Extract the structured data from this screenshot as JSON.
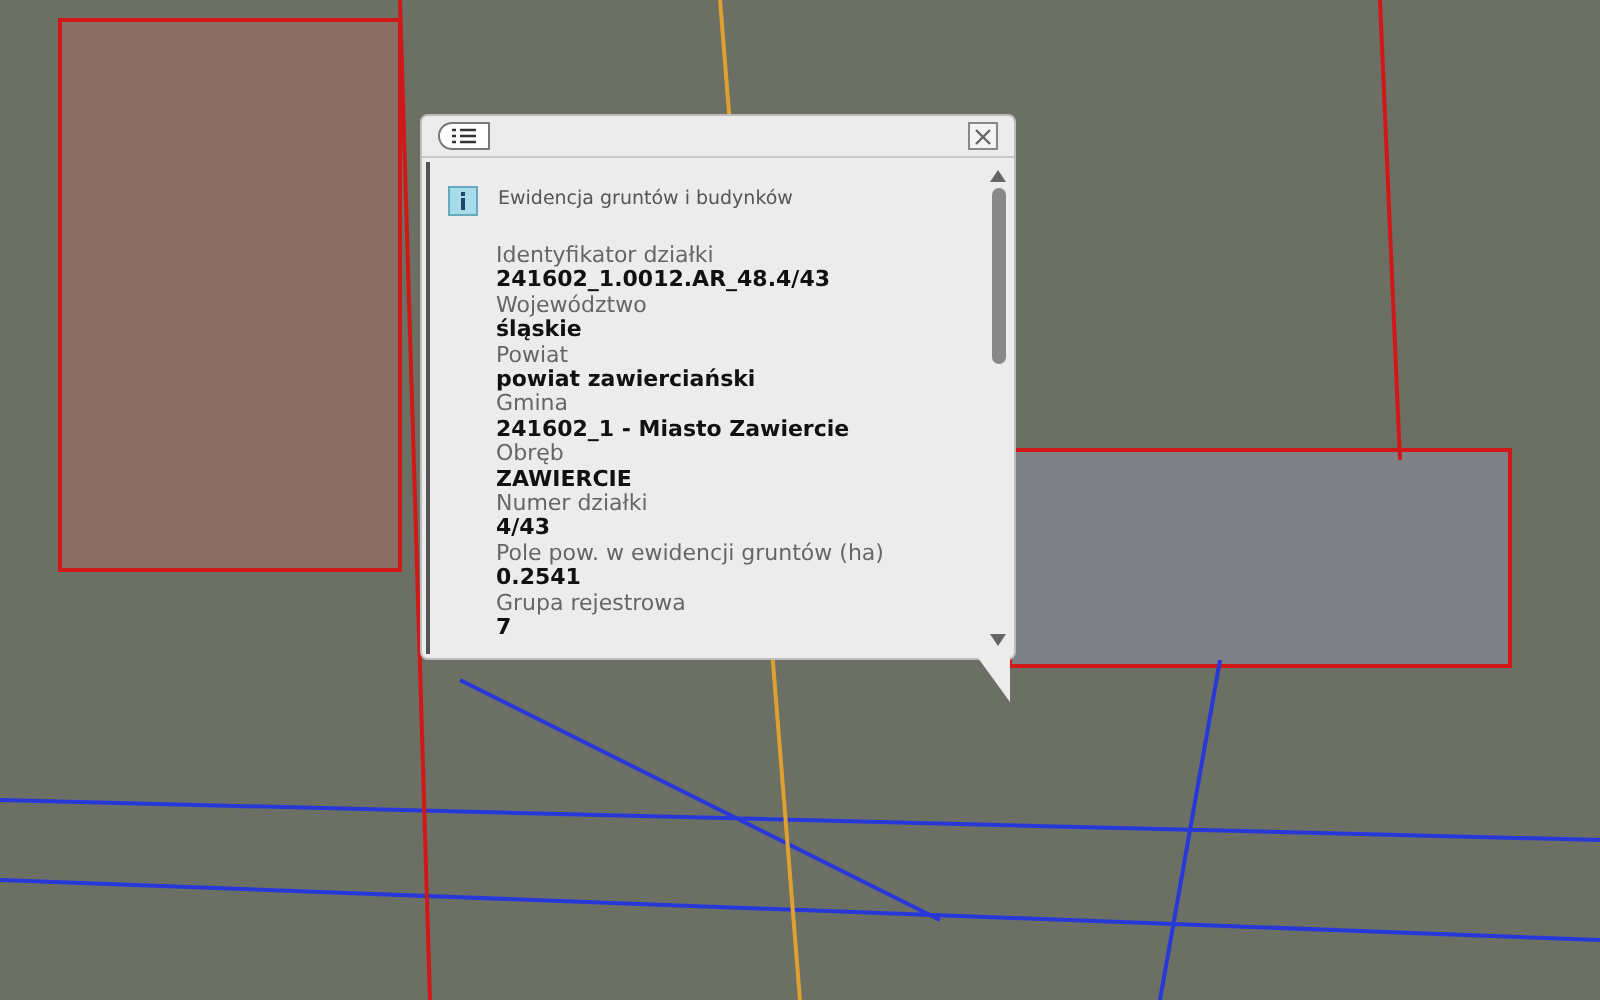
{
  "popup": {
    "title": "Ewidencja gruntów i budynków",
    "fields": [
      {
        "label": "Identyfikator działki",
        "value": "241602_1.0012.AR_48.4/43"
      },
      {
        "label": "Województwo",
        "value": "śląskie"
      },
      {
        "label": "Powiat",
        "value": "powiat zawierciański"
      },
      {
        "label": "Gmina",
        "value": "241602_1 - Miasto Zawiercie"
      },
      {
        "label": "Obręb",
        "value": "ZAWIERCIE"
      },
      {
        "label": "Numer działki",
        "value": "4/43"
      },
      {
        "label": "Pole pow. w ewidencji gruntów (ha)",
        "value": "0.2541"
      },
      {
        "label": "Grupa rejestrowa",
        "value": "7"
      }
    ]
  }
}
